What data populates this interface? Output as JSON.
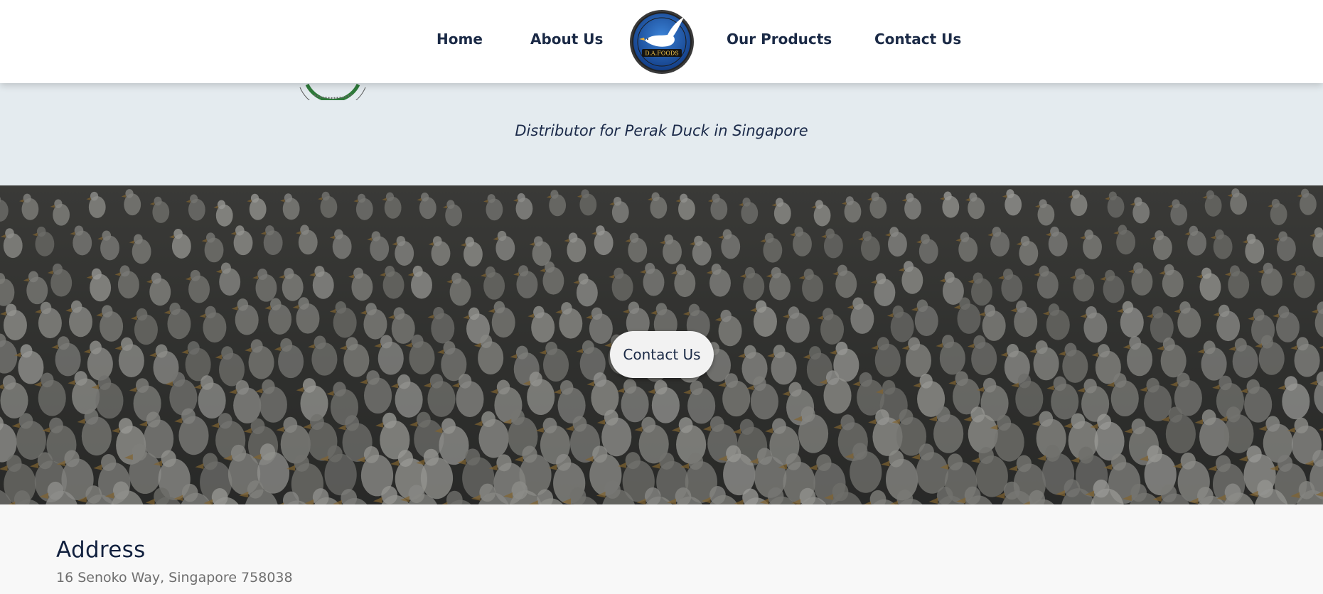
{
  "nav": {
    "items": [
      {
        "label": "Home"
      },
      {
        "label": "About Us"
      },
      {
        "label": "Our Products"
      },
      {
        "label": "Contact Us"
      }
    ],
    "logo_text": "D.A.FOODS"
  },
  "banner": {
    "tagline": "Distributor for Perak Duck in Singapore"
  },
  "hero": {
    "button_label": "Contact Us"
  },
  "address": {
    "heading": "Address",
    "text": "16 Senoko Way, Singapore 758038"
  },
  "colors": {
    "nav_text": "#1b2a46",
    "banner_bg": "#e4ebef",
    "logo_blue": "#1f5fb0",
    "address_heading": "#12213f"
  }
}
